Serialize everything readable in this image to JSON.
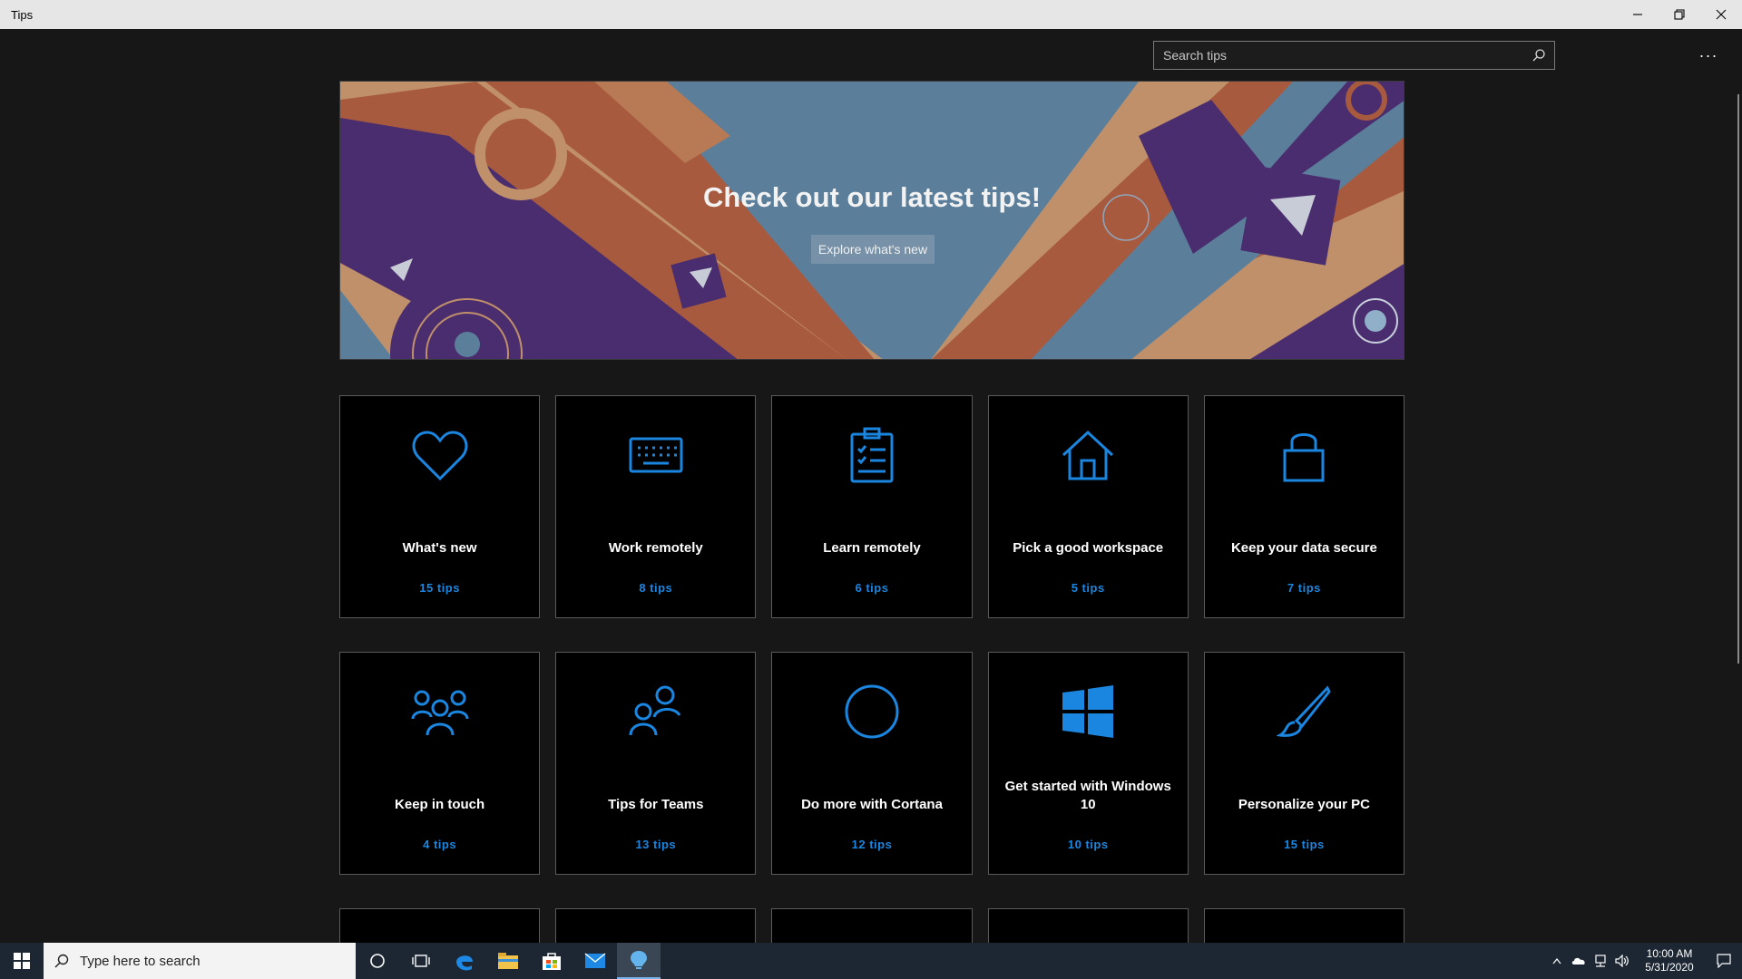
{
  "window": {
    "title": "Tips",
    "controls": [
      "minimize",
      "restore",
      "close"
    ]
  },
  "search": {
    "placeholder": "Search tips",
    "icon": "search-icon"
  },
  "more_label": "···",
  "hero": {
    "title": "Check out our latest tips!",
    "button": "Explore what's new",
    "colors": {
      "sky": "#5b7f9b",
      "purple": "#4a2d6e",
      "rust": "#a85a3e",
      "tan": "#c0906a"
    }
  },
  "cards": {
    "row1": [
      {
        "label": "What's new",
        "count": "15 tips",
        "icon": "heart-icon"
      },
      {
        "label": "Work remotely",
        "count": "8 tips",
        "icon": "keyboard-icon"
      },
      {
        "label": "Learn remotely",
        "count": "6 tips",
        "icon": "clipboard-icon"
      },
      {
        "label": "Pick a good workspace",
        "count": "5 tips",
        "icon": "home-icon"
      },
      {
        "label": "Keep your data secure",
        "count": "7 tips",
        "icon": "lock-icon"
      }
    ],
    "row2": [
      {
        "label": "Keep in touch",
        "count": "4 tips",
        "icon": "people-icon"
      },
      {
        "label": "Tips for Teams",
        "count": "13 tips",
        "icon": "team-icon"
      },
      {
        "label": "Do more with Cortana",
        "count": "12 tips",
        "icon": "cortana-circle-icon"
      },
      {
        "label": "Get started with Windows 10",
        "count": "10 tips",
        "icon": "windows-logo-icon"
      },
      {
        "label": "Personalize your PC",
        "count": "15 tips",
        "icon": "brush-icon"
      }
    ]
  },
  "accent": "#1a86e0",
  "taskbar": {
    "search_placeholder": "Type here to search",
    "apps": [
      "cortana-icon",
      "task-view-icon",
      "edge-icon",
      "file-explorer-icon",
      "store-icon",
      "mail-icon",
      "tips-icon"
    ],
    "clock": {
      "time": "10:00 AM",
      "date": "5/31/2020"
    }
  }
}
